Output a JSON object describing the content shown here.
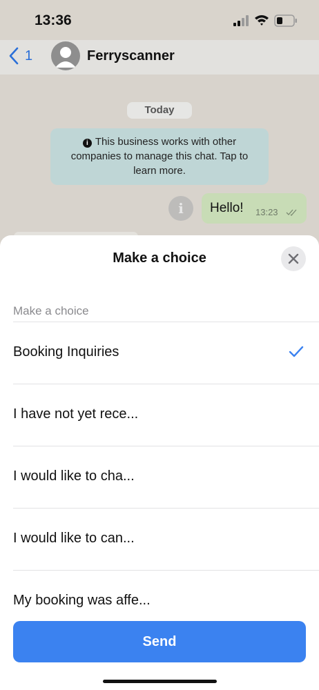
{
  "status_bar": {
    "time": "13:36"
  },
  "header": {
    "back_count": "1",
    "contact_name": "Ferryscanner"
  },
  "chat": {
    "date_chip": "Today",
    "system_notice": "This business works with other companies to manage this chat. Tap to learn more.",
    "outgoing_message": {
      "text": "Hello!",
      "time": "13:23"
    }
  },
  "sheet": {
    "title": "Make a choice",
    "section_label": "Make a choice",
    "options": [
      {
        "label": "Booking Inquiries",
        "selected": true
      },
      {
        "label": "I have not yet rece...",
        "selected": false
      },
      {
        "label": "I would like to cha...",
        "selected": false
      },
      {
        "label": "I would like to can...",
        "selected": false
      },
      {
        "label": "My booking was affe...",
        "selected": false
      }
    ],
    "send_label": "Send"
  },
  "colors": {
    "accent": "#3b82f0",
    "outgoing_bubble": "#c8dcb6",
    "notice_bg": "#bfd6d6",
    "back_link": "#2a6fd8"
  },
  "icons": [
    "back-chevron-icon",
    "avatar-placeholder-icon",
    "signal-icon",
    "wifi-icon",
    "battery-icon",
    "info-icon",
    "double-check-icon",
    "close-icon",
    "checkmark-icon"
  ]
}
